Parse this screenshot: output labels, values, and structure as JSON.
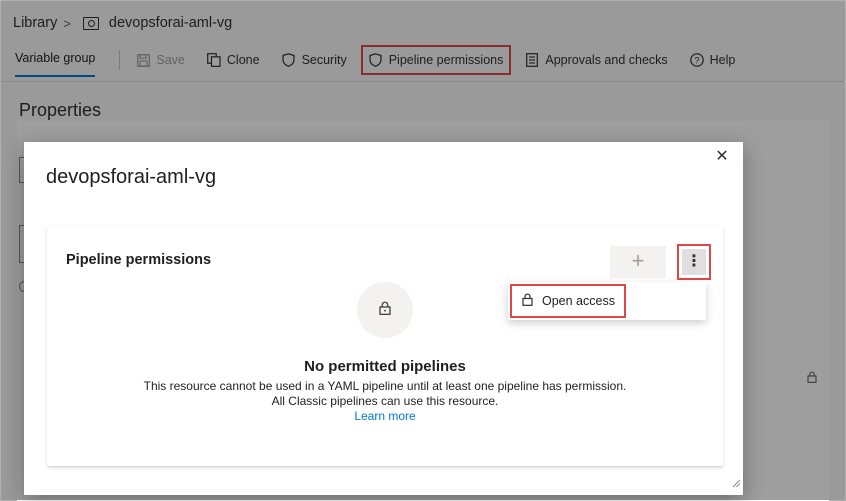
{
  "breadcrumb": {
    "root": "Library",
    "separator": ">",
    "current": "devopsforai-aml-vg",
    "icon": "library-icon"
  },
  "toolbar": {
    "tab_label": "Variable group",
    "save_label": "Save",
    "clone_label": "Clone",
    "security_label": "Security",
    "pipeline_permissions_label": "Pipeline permissions",
    "approvals_label": "Approvals and checks",
    "help_label": "Help"
  },
  "background": {
    "properties_title": "Properties"
  },
  "dialog": {
    "title": "devopsforai-aml-vg",
    "close_icon": "close-icon",
    "card": {
      "title": "Pipeline permissions",
      "add_icon": "plus-icon",
      "more_icon": "more-vertical-icon",
      "empty_state": {
        "icon": "lock-icon",
        "title": "No permitted pipelines",
        "line1": "This resource cannot be used in a YAML pipeline until at least one pipeline has permission.",
        "line2": "All Classic pipelines can use this resource.",
        "link": "Learn more"
      }
    },
    "menu": {
      "items": [
        {
          "label": "Open access",
          "icon": "lock-icon"
        }
      ]
    }
  },
  "colors": {
    "accent": "#0078d4",
    "highlight_box": "#e04848",
    "overlay": "rgba(0,0,0,0.38)"
  }
}
